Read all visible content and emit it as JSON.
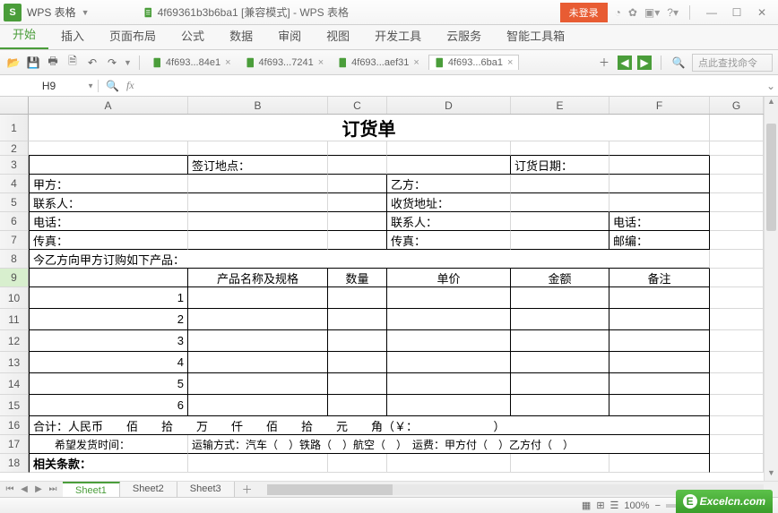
{
  "app": {
    "name": "WPS 表格",
    "logo_letter": "S"
  },
  "titlebar": {
    "doc_title": "4f69361b3b6ba1 [兼容模式] - WPS 表格",
    "login": "未登录"
  },
  "menus": [
    "开始",
    "插入",
    "页面布局",
    "公式",
    "数据",
    "审阅",
    "视图",
    "开发工具",
    "云服务",
    "智能工具箱"
  ],
  "menu_active_index": 0,
  "doc_tabs": [
    {
      "label": "4f693...84e1",
      "active": false
    },
    {
      "label": "4f693...7241",
      "active": false
    },
    {
      "label": "4f693...aef31",
      "active": false
    },
    {
      "label": "4f693...6ba1",
      "active": true
    }
  ],
  "toolbar": {
    "search_placeholder": "点此查找命令"
  },
  "formula": {
    "namebox": "H9",
    "fx": "fx",
    "value": ""
  },
  "columns": [
    {
      "letter": "A",
      "w": 178
    },
    {
      "letter": "B",
      "w": 156
    },
    {
      "letter": "C",
      "w": 66
    },
    {
      "letter": "D",
      "w": 138
    },
    {
      "letter": "E",
      "w": 110
    },
    {
      "letter": "F",
      "w": 112
    },
    {
      "letter": "G",
      "w": 60
    }
  ],
  "row_heights": {
    "title": 30,
    "gap": 16,
    "normal": 21
  },
  "sheet": {
    "title": "订货单",
    "r3": {
      "b": "签订地点：",
      "e": "订货日期："
    },
    "r4": {
      "a": "甲方：",
      "d": "乙方："
    },
    "r5": {
      "a": "联系人：",
      "d": "收货地址："
    },
    "r6": {
      "a": "电话：",
      "d": "联系人：",
      "f": "电话："
    },
    "r7": {
      "a": "传真：",
      "d": "传真：",
      "f": "邮编："
    },
    "r8": {
      "a": "今乙方向甲方订购如下产品："
    },
    "r9": {
      "b": "产品名称及规格",
      "c": "数量",
      "d": "单价",
      "e": "金额",
      "f": "备注"
    },
    "items_a": [
      "1",
      "2",
      "3",
      "4",
      "5",
      "6"
    ],
    "r16": {
      "a": "合计：人民币　　佰　　拾　　万　　仟　　佰　　拾　　元　　角（￥：　　　　　　　）"
    },
    "r17": {
      "a": "　　希望发货时间：",
      "mid": "运输方式：汽车（　）铁路（　）航空（　）　运费：甲方付（　）乙方付（　）"
    },
    "r18": {
      "a": "相关条款："
    }
  },
  "sheets": [
    "Sheet1",
    "Sheet2",
    "Sheet3"
  ],
  "sheet_active_index": 0,
  "zoom": "100%",
  "watermark": "Excelcn.com"
}
